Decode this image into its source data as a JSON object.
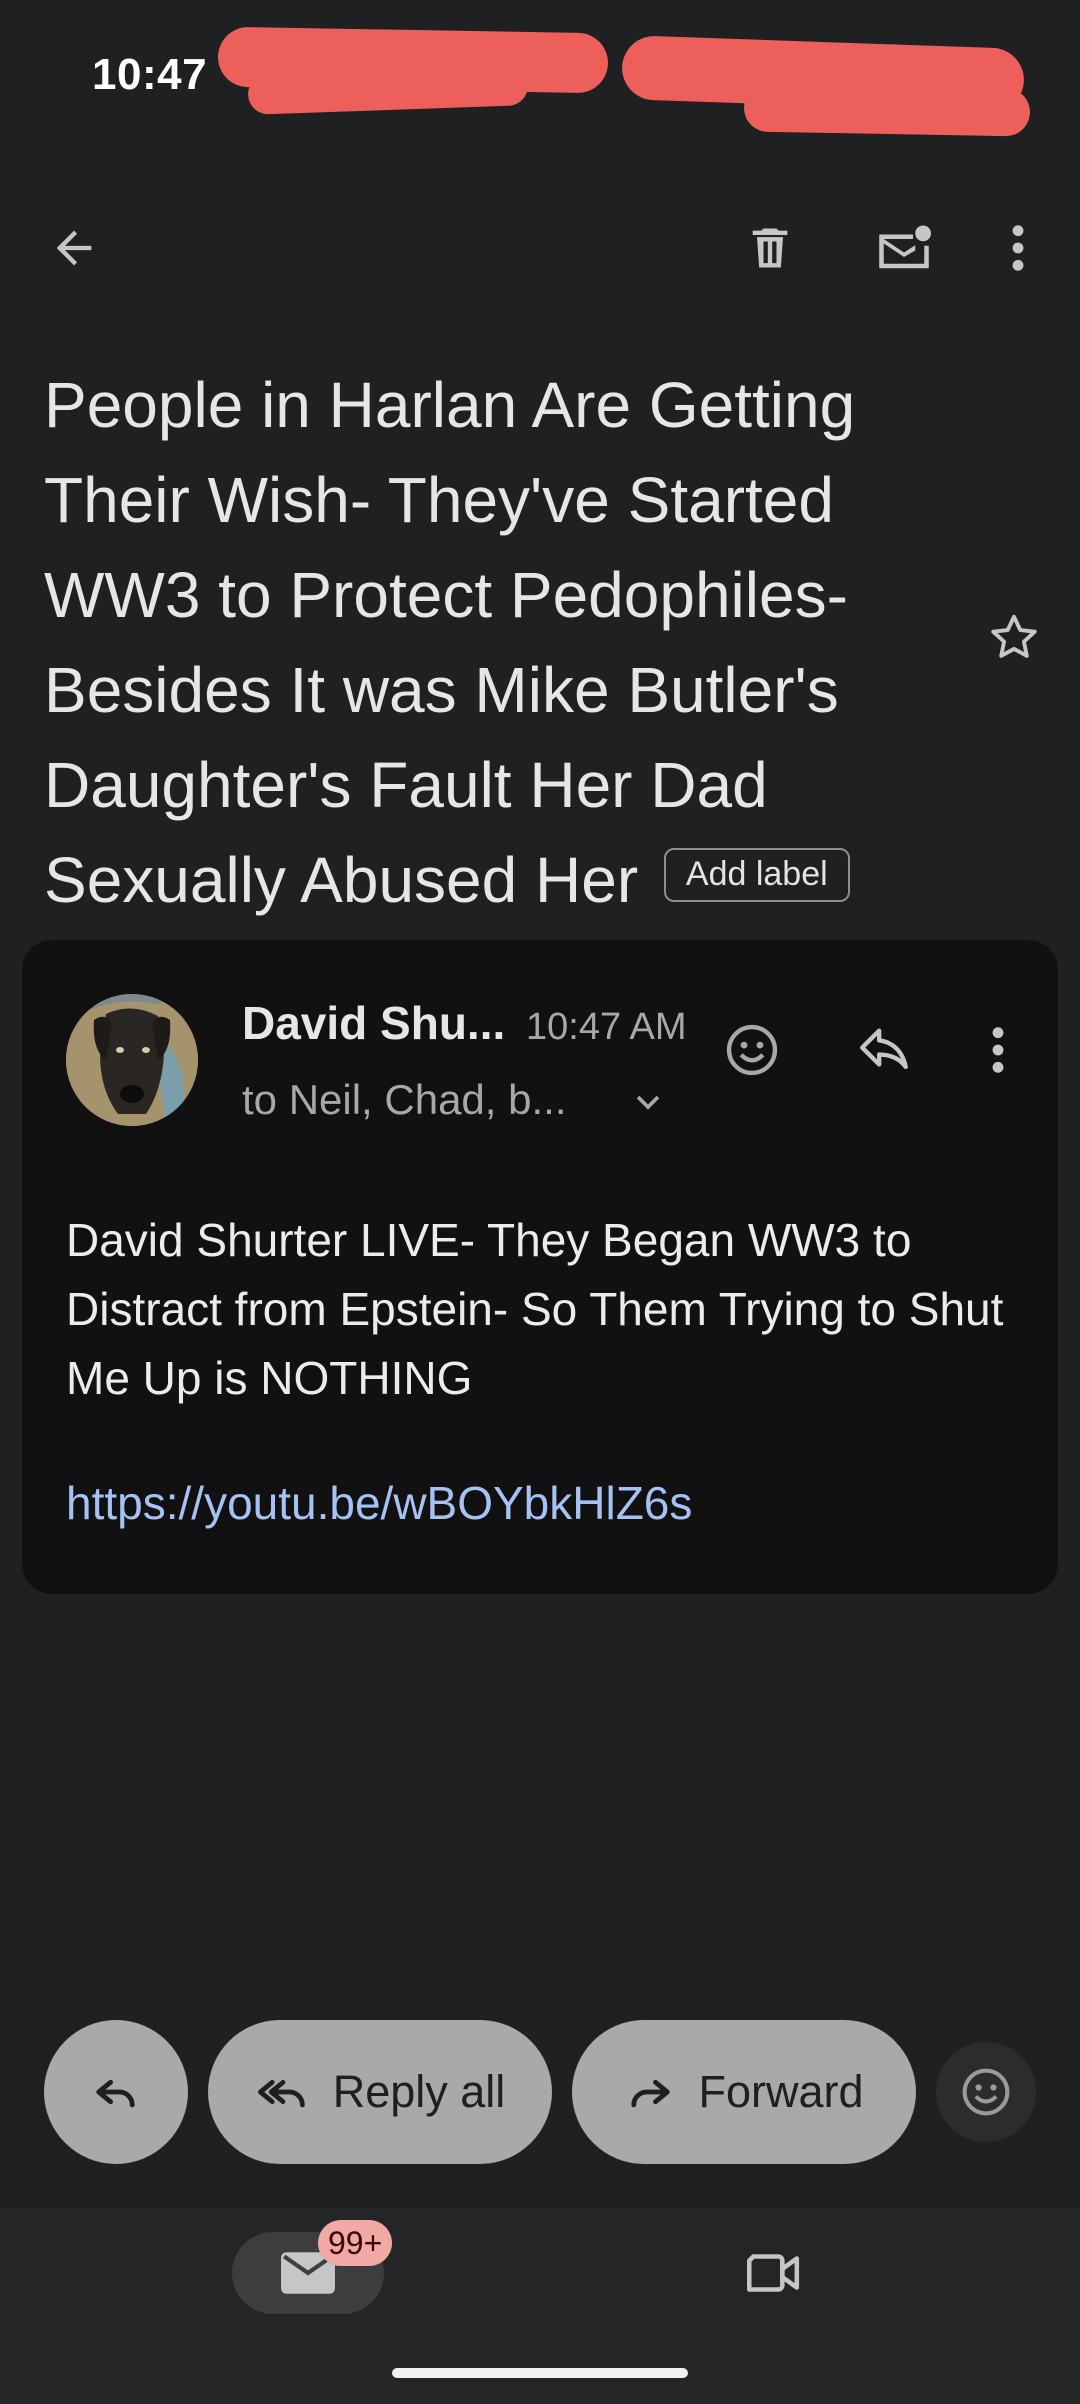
{
  "status_bar": {
    "time": "10:47"
  },
  "subject": {
    "text": "People in Harlan Are Getting Their Wish- They've Started WW3 to Protect Pedophiles- Besides It was Mike Butler's Daughter's Fault Her Dad Sexually Abused Her",
    "add_label": "Add label"
  },
  "message": {
    "sender": "David Shu...",
    "time": "10:47 AM",
    "recipients": "to Neil, Chad, b...",
    "body": "David Shurter LIVE- They Began WW3 to Distract from Epstein- So Them Trying to Shut Me Up is NOTHING",
    "link": "https://youtu.be/wBOYbkHlZ6s"
  },
  "actions": {
    "reply_all": "Reply all",
    "forward": "Forward"
  },
  "nav": {
    "mail_badge": "99+"
  },
  "icons": {
    "top_bar": [
      "back-arrow-icon",
      "trash-icon",
      "mark-unread-icon",
      "more-vert-icon"
    ],
    "subject": [
      "star-icon"
    ],
    "message": [
      "emoji-icon",
      "reply-icon",
      "more-vert-icon",
      "chevron-down-icon"
    ],
    "actions": [
      "reply-icon",
      "reply-all-icon",
      "forward-icon",
      "emoji-icon"
    ],
    "nav": [
      "mail-icon",
      "video-icon"
    ]
  },
  "colors": {
    "background": "#1f2021",
    "card": "#111111",
    "link": "#a6c1f3",
    "pill": "#a9a9a9",
    "badge": "#f2a9a5",
    "redaction": "#ec5f5a"
  }
}
